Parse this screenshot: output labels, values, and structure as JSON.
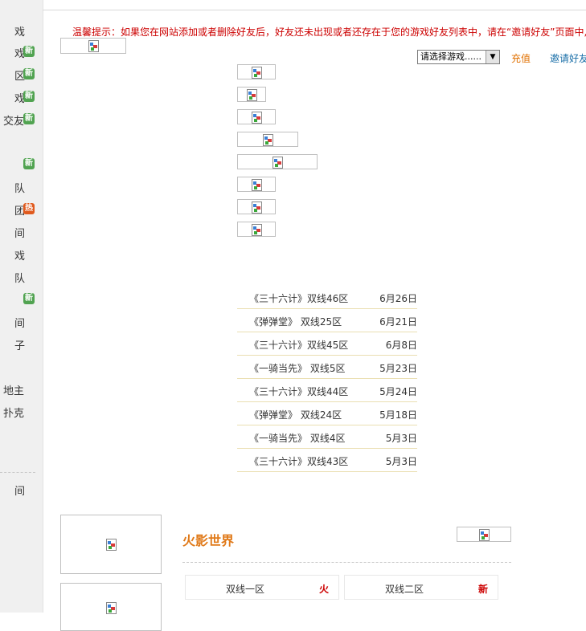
{
  "sidebar": {
    "items": [
      {
        "text": "戏",
        "badge": ""
      },
      {
        "text": "戏",
        "badge": "新"
      },
      {
        "text": "区",
        "badge": "新"
      },
      {
        "text": "戏",
        "badge": "新"
      },
      {
        "text": "交友",
        "badge": "新"
      },
      {
        "text": "",
        "badge": ""
      },
      {
        "text": "",
        "badge": "新"
      },
      {
        "text": "队",
        "badge": ""
      },
      {
        "text": "团",
        "badge": "热"
      },
      {
        "text": "间",
        "badge": ""
      },
      {
        "text": "戏",
        "badge": ""
      },
      {
        "text": "队",
        "badge": ""
      },
      {
        "text": "",
        "badge": "新"
      },
      {
        "text": "间",
        "badge": ""
      },
      {
        "text": "子",
        "badge": ""
      },
      {
        "text": "",
        "badge": ""
      },
      {
        "text": "地主",
        "badge": ""
      },
      {
        "text": "扑克",
        "badge": ""
      },
      {
        "text": "",
        "badge": ""
      },
      {
        "text": "",
        "badge": ""
      },
      {
        "text": "间",
        "badge": ""
      }
    ]
  },
  "notice": "温馨提示：如果您在网站添加或者删除好友后，好友还未出现或者还存在于您的游戏好友列表中，请在“邀请好友”页面中,",
  "toolbar": {
    "game_select": "请选择游戏......",
    "recharge": "充值",
    "invite": "邀请好友"
  },
  "servers": [
    {
      "name": "《三十六计》双线46区",
      "date": "6月26日"
    },
    {
      "name": "《弹弹堂》 双线25区",
      "date": "6月21日"
    },
    {
      "name": "《三十六计》双线45区",
      "date": "6月8日"
    },
    {
      "name": "《一骑当先》 双线5区",
      "date": "5月23日"
    },
    {
      "name": "《三十六计》双线44区",
      "date": "5月24日"
    },
    {
      "name": "《弹弹堂》 双线24区",
      "date": "5月18日"
    },
    {
      "name": "《一骑当先》 双线4区",
      "date": "5月3日"
    },
    {
      "name": "《三十六计》双线43区",
      "date": "5月3日"
    }
  ],
  "featured": {
    "title": "火影世界",
    "zones": [
      {
        "name": "双线一区",
        "tag": "火"
      },
      {
        "name": "双线二区",
        "tag": "新"
      }
    ]
  },
  "colors": {
    "notice": "#cc0000",
    "accent_orange": "#e07a1a",
    "link_blue": "#1a6fa8",
    "badge_new": "#51a351",
    "badge_hot": "#e05a1e"
  }
}
